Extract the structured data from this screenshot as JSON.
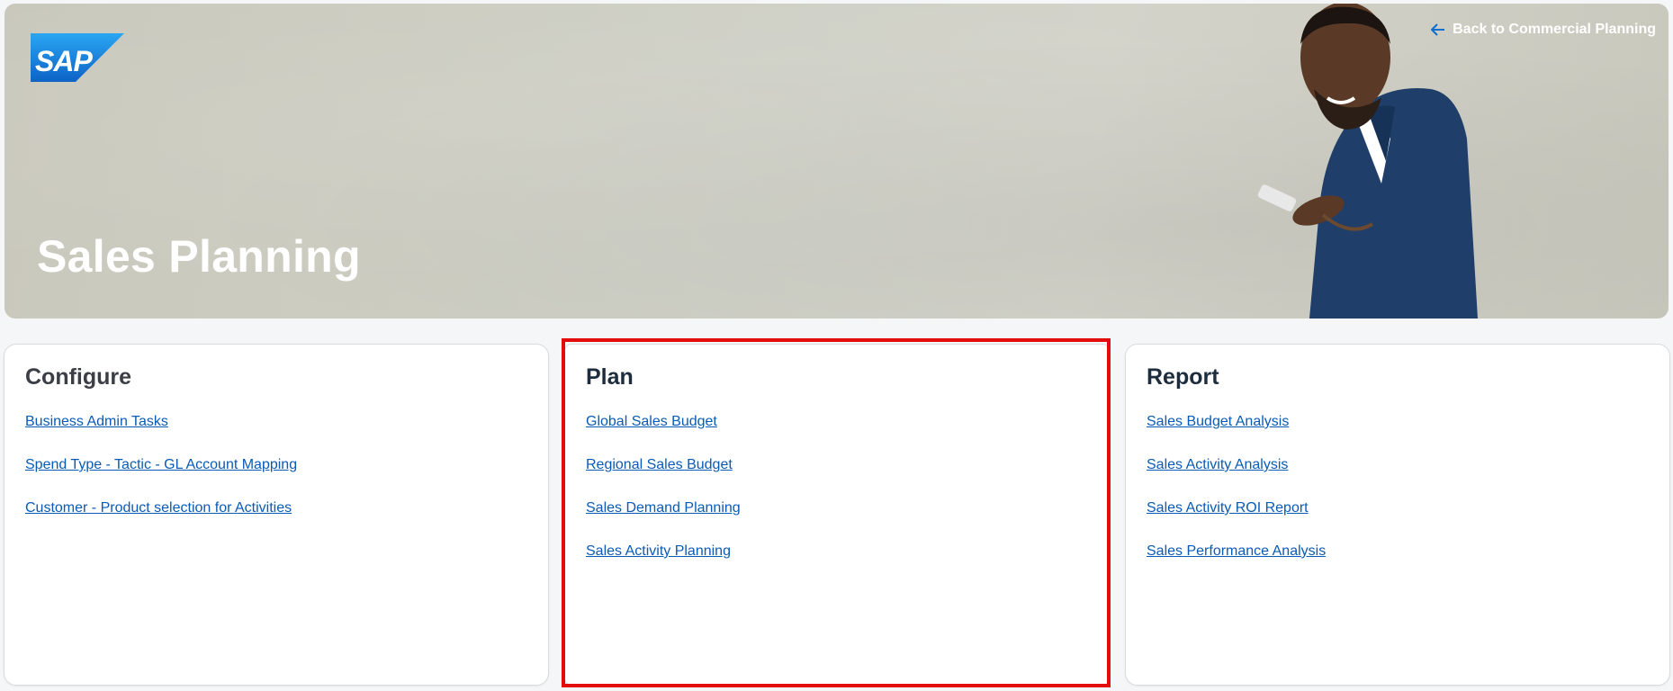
{
  "header": {
    "logo_text": "SAP",
    "back_link_label": "Back to Commercial Planning",
    "title": "Sales Planning"
  },
  "sections": [
    {
      "title": "Configure",
      "links": [
        "Business Admin Tasks",
        "Spend Type - Tactic - GL Account Mapping",
        "Customer - Product selection for Activities"
      ]
    },
    {
      "title": "Plan",
      "links": [
        "Global Sales Budget",
        "Regional Sales Budget",
        "Sales Demand Planning",
        "Sales Activity Planning"
      ]
    },
    {
      "title": "Report",
      "links": [
        "Sales Budget Analysis",
        "Sales Activity Analysis",
        "Sales Activity ROI Report",
        "Sales Performance Analysis"
      ]
    }
  ],
  "colors": {
    "link": "#0a5bb5",
    "sap_blue": "#1873d2",
    "highlight_border": "#e30b0b"
  },
  "icons": {
    "back": "arrow-left-icon",
    "logo": "sap-logo"
  }
}
